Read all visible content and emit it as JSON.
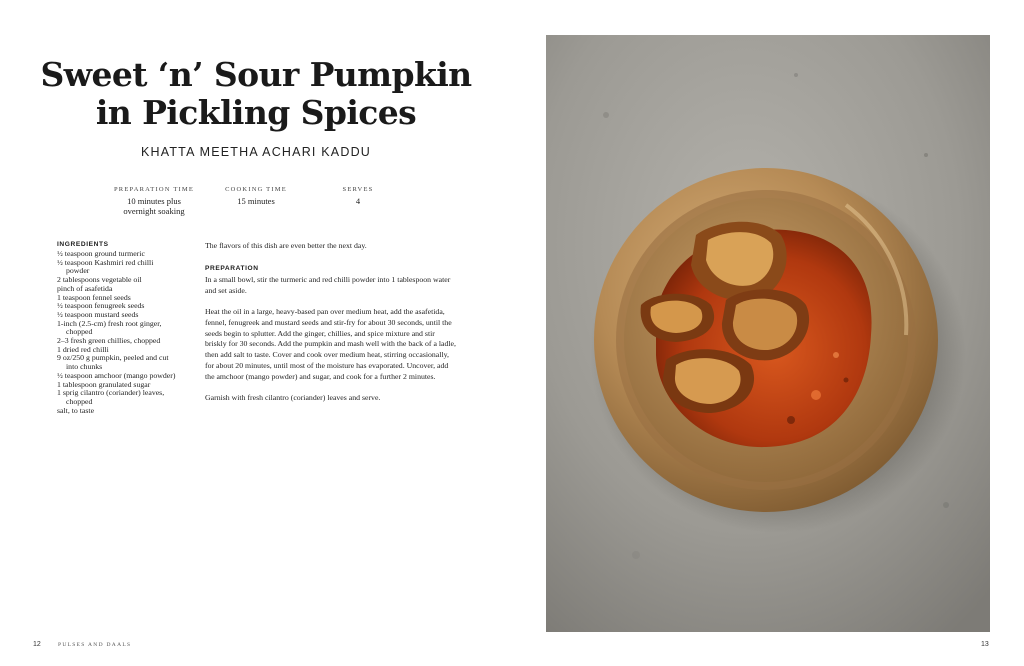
{
  "recipe": {
    "title_line1": "Sweet ‘n’ Sour Pumpkin",
    "title_line2": "in Pickling Spices",
    "subtitle": "KHATTA MEETHA ACHARI KADDU",
    "meta": [
      {
        "label": "PREPARATION TIME",
        "value": "10 minutes plus\novernight soaking"
      },
      {
        "label": "COOKING TIME",
        "value": "15 minutes"
      },
      {
        "label": "SERVES",
        "value": "4"
      }
    ],
    "ingredients_heading": "INGREDIENTS",
    "ingredients": [
      "½ teaspoon ground turmeric",
      "½ teaspoon Kashmiri red chilli powder",
      "2 tablespoons vegetable oil",
      "pinch of asafetida",
      "1 teaspoon fennel seeds",
      "½ teaspoon fenugreek seeds",
      "½ teaspoon mustard seeds",
      "1-inch (2.5-cm) fresh root ginger, chopped",
      "2–3 fresh green chillies, chopped",
      "1 dried red chilli",
      "9 oz/250 g pumpkin, peeled and cut into chunks",
      "½ teaspoon amchoor (mango powder)",
      "1 tablespoon granulated sugar",
      "1 sprig cilantro (coriander) leaves, chopped",
      "salt, to taste"
    ],
    "intro": "The flavors of this dish are even better the next day.",
    "preparation_heading": "PREPARATION",
    "steps": [
      "In a small bowl, stir the turmeric and red chilli powder into 1 tablespoon water and set aside.",
      "Heat the oil in a large, heavy-based pan over medium heat, add the asafetida, fennel, fenugreek and mustard seeds and stir-fry for about 30 seconds, until the seeds begin to splutter. Add the ginger, chillies, and spice mixture and stir briskly for 30 seconds. Add the pumpkin and mash well with the back of a ladle, then add salt to taste. Cover and cook over medium heat, stirring occasionally, for about 20 minutes, until most of the moisture has evaporated. Uncover, add the amchoor (mango powder) and sugar, and cook for a further 2 minutes.",
      "Garnish with fresh cilantro (coriander) leaves and serve."
    ]
  },
  "footer": {
    "left_page_number": "12",
    "section": "PULSES AND DAALS",
    "right_page_number": "13"
  },
  "colors": {
    "background": "#ffffff",
    "text": "#1c1c1c",
    "stone": "#9a9892",
    "brass_bowl": "#b58a55",
    "sauce": "#c8481a"
  },
  "photo": {
    "subject": "pumpkin-dish-in-brass-bowl"
  }
}
